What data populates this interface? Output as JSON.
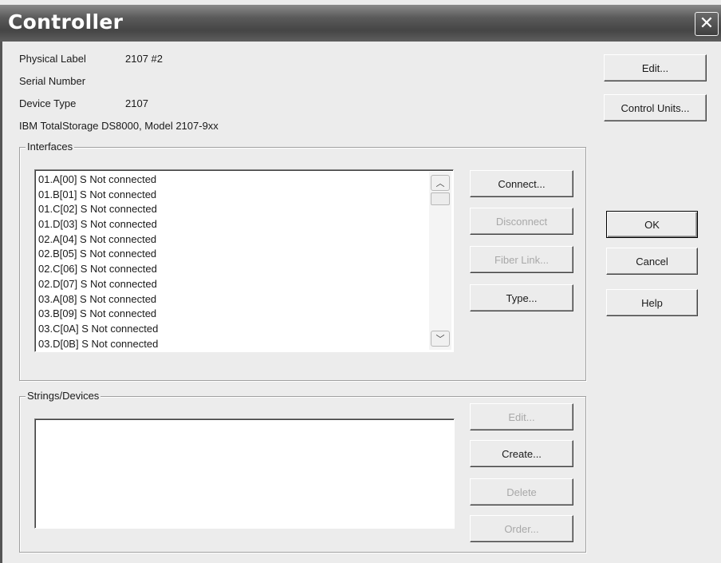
{
  "window": {
    "title": "Controller"
  },
  "info": {
    "physical_label_caption": "Physical Label",
    "physical_label_value": "2107 #2",
    "serial_number_caption": "Serial Number",
    "device_type_caption": "Device Type",
    "device_type_value": "2107",
    "model_description": "IBM TotalStorage DS8000, Model 2107-9xx"
  },
  "right_buttons": {
    "edit": "Edit...",
    "control_units": "Control Units...",
    "ok": "OK",
    "cancel": "Cancel",
    "help": "Help"
  },
  "interfaces": {
    "title": "Interfaces",
    "items": [
      "01.A[00] S Not connected",
      "01.B[01] S Not connected",
      "01.C[02] S Not connected",
      "01.D[03] S Not connected",
      "02.A[04] S Not connected",
      "02.B[05] S Not connected",
      "02.C[06] S Not connected",
      "02.D[07] S Not connected",
      "03.A[08] S Not connected",
      "03.B[09] S Not connected",
      "03.C[0A] S Not connected",
      "03.D[0B] S Not connected"
    ],
    "buttons": {
      "connect": "Connect...",
      "disconnect": "Disconnect",
      "fiber_link": "Fiber Link...",
      "type": "Type..."
    }
  },
  "strings": {
    "title": "Strings/Devices",
    "items": [],
    "buttons": {
      "edit": "Edit...",
      "create": "Create...",
      "delete": "Delete",
      "order": "Order..."
    }
  }
}
